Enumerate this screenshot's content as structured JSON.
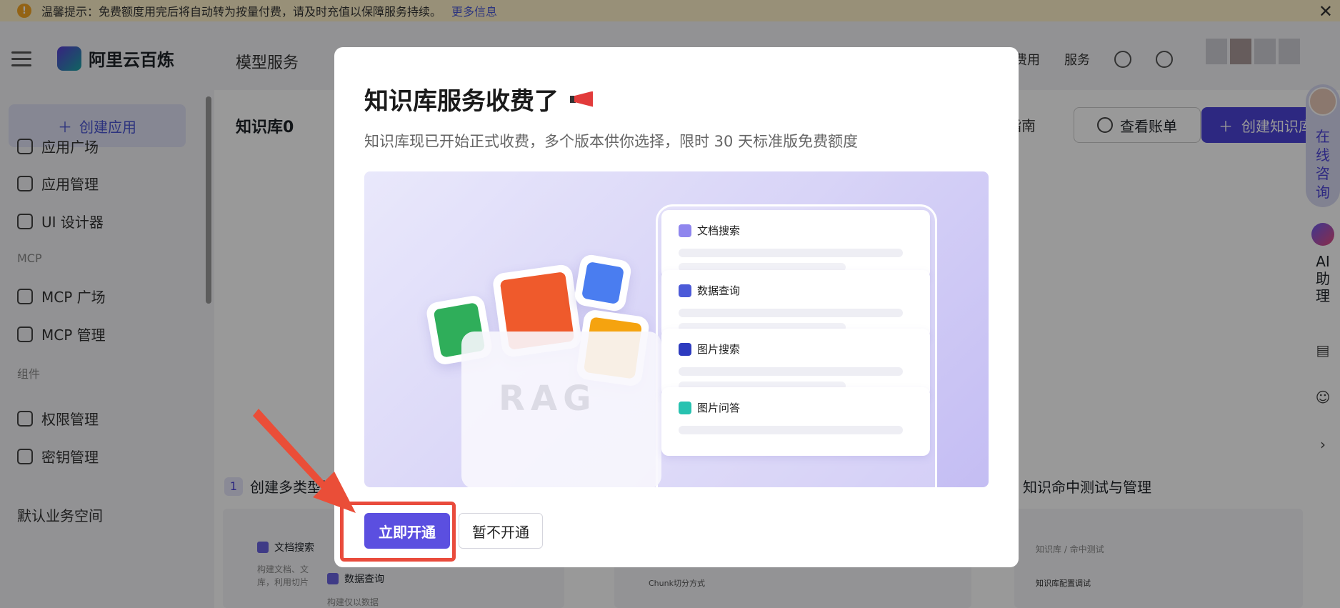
{
  "notice": {
    "icon": "warning-icon",
    "text": "温馨提示：免费额度用完后将自动转为按量付费，请及时充值以保障服务持续。",
    "link": "更多信息",
    "close": "✕"
  },
  "header": {
    "brand": "阿里云百炼",
    "nav": "模型服务",
    "right": [
      "费用",
      "服务"
    ]
  },
  "sidebar": {
    "create_app": "创建应用",
    "items_top": [
      "应用广场",
      "应用管理",
      "UI 设计器"
    ],
    "group_mcp": "MCP",
    "items_mcp": [
      "MCP 广场",
      "MCP 管理"
    ],
    "group_components": "组件",
    "items_components": [
      "权限管理",
      "密钥管理"
    ],
    "workspace": "默认业务空间"
  },
  "main": {
    "title": "知识库0",
    "guide": "指南",
    "bill_button": "查看账单",
    "create_kb_button": "创建知识库",
    "step1_num": "1",
    "step1": "创建多类型知",
    "step3": "知识命中测试与管理",
    "mini_doc": "文档搜索",
    "mini_doc_text": [
      "构建文档、文",
      "库，利用切片"
    ],
    "mini_data": "数据查询",
    "mini_data_text": "构建仅以数据",
    "mini_chunk": "Chunk切分方式",
    "mini_breadcrumb": "知识库 / 命中测试",
    "mini_config": "知识库配置调试"
  },
  "float": {
    "consult": [
      "在",
      "线",
      "咨",
      "询"
    ],
    "ai": [
      "AI",
      "助",
      "理"
    ]
  },
  "modal": {
    "title": "知识库服务收费了",
    "subtitle": "知识库现已开始正式收费，多个版本供你选择，限时 30 天标准版免费额度",
    "illustration": {
      "watermark": "RAG",
      "features": [
        {
          "name": "文档搜索",
          "color": "#8f86ee"
        },
        {
          "name": "数据查询",
          "color": "#4c5ad8"
        },
        {
          "name": "图片搜索",
          "color": "#2d3bbf"
        },
        {
          "name": "图片问答",
          "color": "#27c2b0"
        }
      ]
    },
    "primary_button": "立即开通",
    "secondary_button": "暂不开通"
  },
  "colors": {
    "accent": "#5b4fe0",
    "highlight": "#e94b3c",
    "notice_bg": "#fdf1c9"
  }
}
